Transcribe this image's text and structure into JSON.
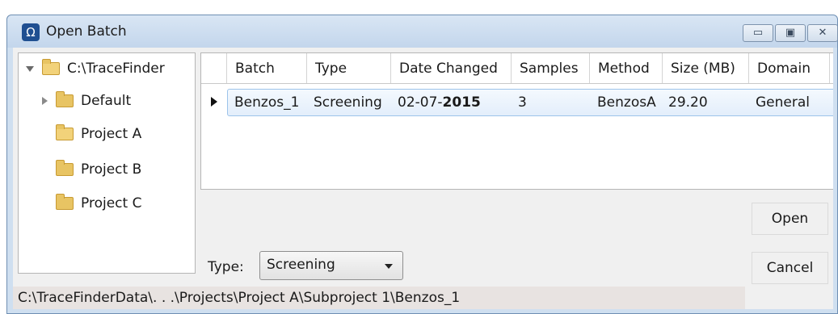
{
  "window": {
    "title": "Open Batch",
    "app_icon": "trace-finder-logo-icon",
    "minimize_glyph": "▭",
    "maximize_glyph": "▣",
    "close_glyph": "✕"
  },
  "tree": {
    "root_label": "C:\\TraceFinder",
    "items": [
      {
        "label": "Default",
        "expandable": true
      },
      {
        "label": "Project A",
        "open": true
      },
      {
        "label": "Project B"
      },
      {
        "label": "Project C"
      }
    ]
  },
  "grid": {
    "columns": [
      "Batch",
      "Type",
      "Date Changed",
      "Samples",
      "Method",
      "Size (MB)",
      "Domain"
    ],
    "rows": [
      {
        "batch": "Benzos_1",
        "type": "Screening",
        "date_prefix": "02-07-",
        "date_year": "2015",
        "samples": "3",
        "method": "BenzosA",
        "size": "29.20",
        "domain": "General"
      }
    ]
  },
  "buttons": {
    "open": "Open",
    "cancel": "Cancel"
  },
  "type_filter": {
    "label": "Type:",
    "value": "Screening"
  },
  "status_path": "C:\\TraceFinderData\\. . .\\Projects\\Project A\\Subproject 1\\Benzos_1",
  "colors": {
    "selection": "#e3eefb",
    "selection_border": "#9cc3ea",
    "titlebar": "#c3d6ec"
  }
}
